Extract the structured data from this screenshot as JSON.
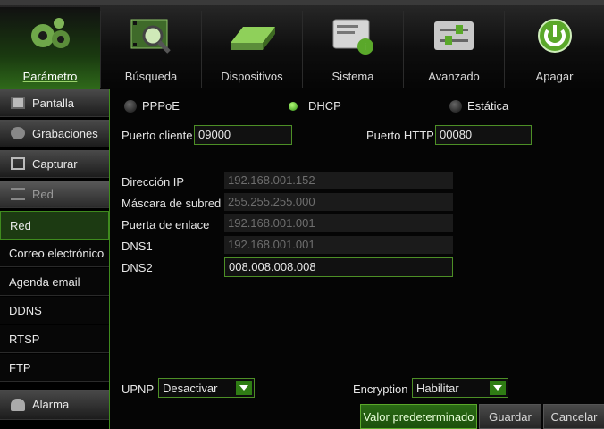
{
  "toolbar": {
    "items": [
      {
        "label": "Parámetro",
        "icon": "gears-icon"
      },
      {
        "label": "Búsqueda",
        "icon": "film-search-icon"
      },
      {
        "label": "Dispositivos",
        "icon": "hard-drive-icon"
      },
      {
        "label": "Sistema",
        "icon": "system-info-icon"
      },
      {
        "label": "Avanzado",
        "icon": "sliders-icon"
      },
      {
        "label": "Apagar",
        "icon": "power-icon"
      }
    ],
    "active": "Parámetro"
  },
  "sidebar": {
    "pantalla": "Pantalla",
    "grabaciones": "Grabaciones",
    "capturar": "Capturar",
    "red_header": "Red",
    "sub": [
      "Red",
      "Correo electrónico",
      "Agenda email",
      "DDNS",
      "RTSP",
      "FTP"
    ],
    "alarma": "Alarma"
  },
  "network": {
    "modes": {
      "pppoe": "PPPoE",
      "dhcp": "DHCP",
      "estatica": "Estática",
      "selected": "DHCP"
    },
    "puerto_cliente_label": "Puerto cliente",
    "puerto_cliente": "09000",
    "puerto_http_label": "Puerto HTTP",
    "puerto_http": "00080",
    "ip_label": "Dirección IP",
    "ip": "192.168.001.152",
    "mask_label": "Máscara de subred",
    "mask": "255.255.255.000",
    "gateway_label": "Puerta de enlace",
    "gateway": "192.168.001.001",
    "dns1_label": "DNS1",
    "dns1": "192.168.001.001",
    "dns2_label": "DNS2",
    "dns2": "008.008.008.008",
    "upnp_label": "UPNP",
    "upnp": "Desactivar",
    "encryption_label": "Encryption",
    "encryption": "Habilitar"
  },
  "buttons": {
    "default": "Valor predeterminado",
    "save": "Guardar",
    "cancel": "Cancelar"
  },
  "colors": {
    "accent": "#3f8a1e",
    "active_bg": "#1c3a12"
  }
}
